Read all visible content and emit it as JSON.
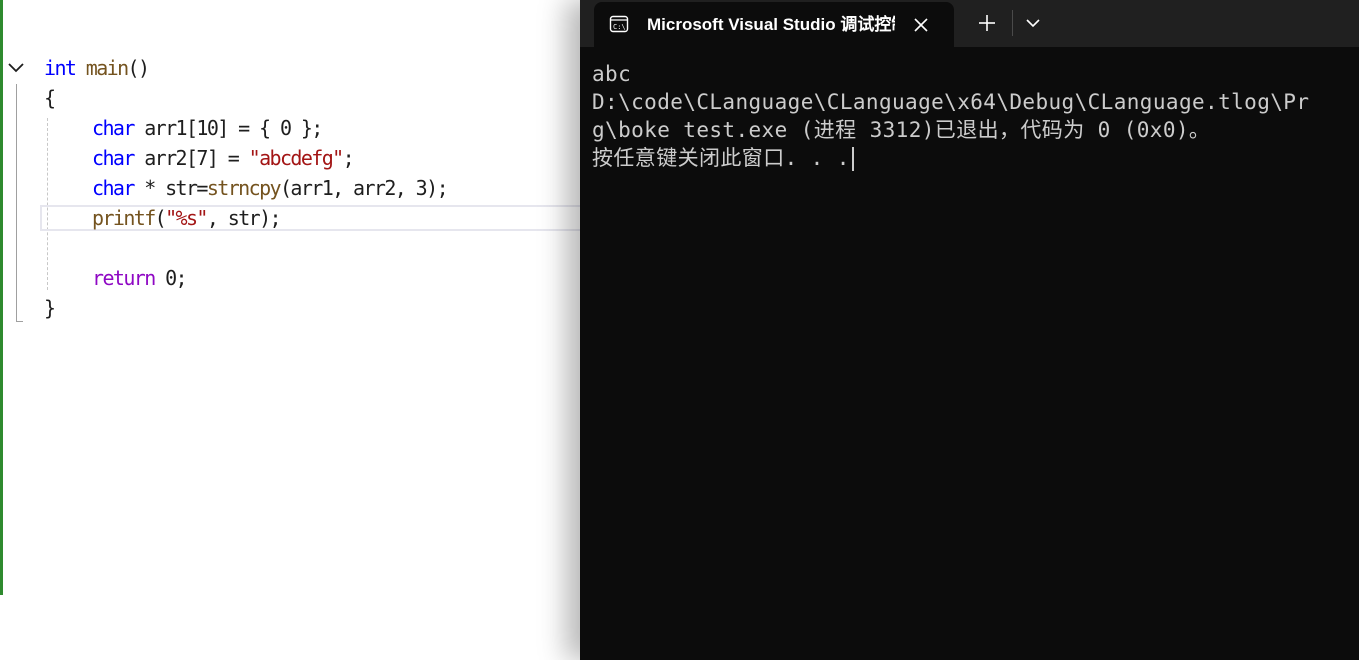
{
  "editor": {
    "lines": [
      [
        {
          "t": "int",
          "c": "kw"
        },
        {
          "t": " ",
          "c": "plain"
        },
        {
          "t": "main",
          "c": "fn"
        },
        {
          "t": "()",
          "c": "plain"
        }
      ],
      [
        {
          "t": "{",
          "c": "plain"
        }
      ],
      [
        {
          "t": "char",
          "c": "kw"
        },
        {
          "t": " arr1[10] = { 0 };",
          "c": "plain"
        }
      ],
      [
        {
          "t": "char",
          "c": "kw"
        },
        {
          "t": " arr2[7] = ",
          "c": "plain"
        },
        {
          "t": "\"abcdefg\"",
          "c": "str"
        },
        {
          "t": ";",
          "c": "plain"
        }
      ],
      [
        {
          "t": "char",
          "c": "kw"
        },
        {
          "t": " * str=",
          "c": "plain"
        },
        {
          "t": "strncpy",
          "c": "fn"
        },
        {
          "t": "(arr1, arr2, 3);",
          "c": "plain"
        }
      ],
      [
        {
          "t": "printf",
          "c": "fn"
        },
        {
          "t": "(",
          "c": "plain"
        },
        {
          "t": "\"%s\"",
          "c": "str"
        },
        {
          "t": ", str);",
          "c": "plain"
        }
      ],
      [],
      [
        {
          "t": "return",
          "c": "kw2"
        },
        {
          "t": " 0;",
          "c": "plain"
        }
      ],
      [
        {
          "t": "}",
          "c": "plain"
        }
      ]
    ]
  },
  "terminal": {
    "tab_title": "Microsoft Visual Studio 调试控制台",
    "output": [
      "abc",
      "D:\\code\\CLanguage\\CLanguage\\x64\\Debug\\CLanguage.tlog\\Pr",
      "g\\boke test.exe (进程 3312)已退出，代码为 0 (0x0)。",
      "按任意键关闭此窗口. . ."
    ]
  },
  "colors": {
    "terminal_bg": "#0c0c0c",
    "titlebar_bg": "#202020",
    "keyword": "#0000ff",
    "control_keyword": "#8f08c4",
    "function": "#74531f",
    "string": "#a31515",
    "change_bar": "#2f8a2f"
  },
  "icons": {
    "tab": "terminal-icon",
    "close": "close-icon",
    "new_tab": "plus-icon",
    "dropdown": "chevron-down-icon",
    "fold": "chevron-down-icon"
  }
}
